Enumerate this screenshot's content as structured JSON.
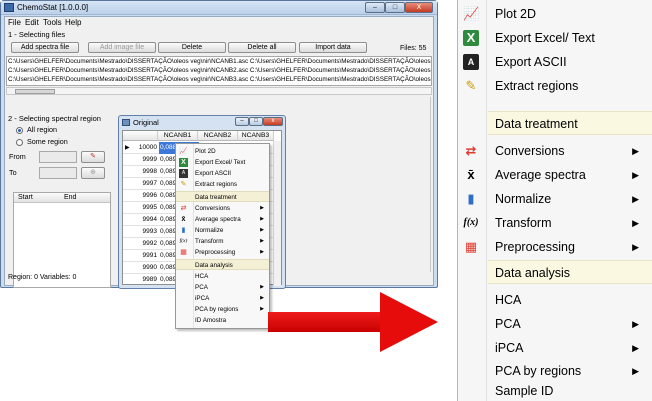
{
  "window": {
    "title": "ChemoStat [1.0.0.0]",
    "buttons": {
      "minimize": "–",
      "maximize": "□",
      "close": "X"
    }
  },
  "menubar": [
    "File",
    "Edit",
    "Tools",
    "Help"
  ],
  "files_section": {
    "title": "1 - Selecting files",
    "buttons": [
      "Add spectra file",
      "Add image file",
      "Delete",
      "Delete all",
      "Import data"
    ],
    "files_count": "Files: 55",
    "paths": [
      "C:\\Users\\GHELFER\\Documents\\Mestrado\\DISSERTAÇÃO\\oleos veg\\nir\\NCANB1.asc   C:\\Users\\GHELFER\\Documents\\Mestrado\\DISSERTAÇÃO\\oleos veg\\",
      "C:\\Users\\GHELFER\\Documents\\Mestrado\\DISSERTAÇÃO\\oleos veg\\nir\\NCANB2.asc   C:\\Users\\GHELFER\\Documents\\Mestrado\\DISSERTAÇÃO\\oleos veg\\",
      "C:\\Users\\GHELFER\\Documents\\Mestrado\\DISSERTAÇÃO\\oleos veg\\nir\\NCANB3.asc   C:\\Users\\GHELFER\\Documents\\Mestrado\\DISSERTAÇÃO\\oleos veg\\"
    ]
  },
  "region_section": {
    "title": "2 - Selecting spectral region",
    "options": [
      "All region",
      "Some region"
    ],
    "selected": "All region",
    "from_label": "From",
    "to_label": "To",
    "table_headers": [
      "Start",
      "End"
    ],
    "status": "Region: 0  Variables: 0"
  },
  "inner_window": {
    "title": "Original",
    "columns": [
      "NCANB1",
      "NCANB2",
      "NCANB3"
    ],
    "rows": [
      {
        "id": "10000",
        "v1": "0,08875",
        "v3": "0,"
      },
      {
        "id": "9999",
        "v1": "0,089170",
        "v3": "0,"
      },
      {
        "id": "9998",
        "v1": "0,08954",
        "v3": "0,"
      },
      {
        "id": "9997",
        "v1": "0,08969",
        "v3": "0,"
      },
      {
        "id": "9996",
        "v1": "0,08956",
        "v3": "0,"
      },
      {
        "id": "9995",
        "v1": "0,08931",
        "v3": "0,"
      },
      {
        "id": "9994",
        "v1": "0,089163",
        "v3": "0,"
      },
      {
        "id": "9993",
        "v1": "0,089205",
        "v3": "0,"
      },
      {
        "id": "9992",
        "v1": "0,089360",
        "v3": "0,"
      },
      {
        "id": "9991",
        "v1": "0,089465",
        "v3": "0,"
      },
      {
        "id": "9990",
        "v1": "0,089375",
        "v3": "0,"
      },
      {
        "id": "9989",
        "v1": "0,089153",
        "v3": "0,"
      }
    ]
  },
  "context_menu_small": [
    {
      "label": "Plot 2D",
      "icon": "plot-2d-icon",
      "glyph": "📈"
    },
    {
      "label": "Export Excel/ Text",
      "icon": "excel-icon",
      "glyph": "X"
    },
    {
      "label": "Export ASCII",
      "icon": "ascii-icon",
      "glyph": "A"
    },
    {
      "label": "Extract regions",
      "icon": "wand-icon",
      "glyph": "✎"
    },
    {
      "label": "Data treatment",
      "header": true
    },
    {
      "label": "Conversions",
      "icon": "conversions-icon",
      "glyph": "⇄",
      "submenu": true
    },
    {
      "label": "Average spectra",
      "icon": "average-icon",
      "glyph": "x̄",
      "submenu": true
    },
    {
      "label": "Normalize",
      "icon": "normalize-icon",
      "glyph": "▮",
      "submenu": true
    },
    {
      "label": "Transform",
      "icon": "transform-icon",
      "glyph": "f(x)",
      "submenu": true
    },
    {
      "label": "Preprocessing",
      "icon": "preprocessing-icon",
      "glyph": "▦",
      "submenu": true
    },
    {
      "label": "Data analysis",
      "header": true
    },
    {
      "label": "HCA"
    },
    {
      "label": "PCA",
      "submenu": true
    },
    {
      "label": "iPCA",
      "submenu": true
    },
    {
      "label": "PCA by regions",
      "submenu": true
    },
    {
      "label": "ID Amostra"
    }
  ],
  "context_menu_big": [
    {
      "label": "Plot 2D",
      "icon": "plot-2d-icon",
      "glyph": "📈"
    },
    {
      "label": "Export Excel/ Text",
      "icon": "excel-icon",
      "glyph": "X"
    },
    {
      "label": "Export ASCII",
      "icon": "ascii-icon",
      "glyph": "A"
    },
    {
      "label": "Extract regions",
      "icon": "wand-icon",
      "glyph": "✎"
    },
    {
      "label": "Data treatment",
      "header": true
    },
    {
      "label": "Conversions",
      "icon": "conversions-icon",
      "glyph": "⇄",
      "submenu": true
    },
    {
      "label": "Average spectra",
      "icon": "average-icon",
      "glyph": "x̄",
      "submenu": true
    },
    {
      "label": "Normalize",
      "icon": "normalize-icon",
      "glyph": "▮",
      "submenu": true
    },
    {
      "label": "Transform",
      "icon": "transform-icon",
      "glyph": "f(x)",
      "submenu": true
    },
    {
      "label": "Preprocessing",
      "icon": "preprocessing-icon",
      "glyph": "▦",
      "submenu": true
    },
    {
      "label": "Data analysis",
      "header": true
    },
    {
      "label": "HCA"
    },
    {
      "label": "PCA",
      "submenu": true
    },
    {
      "label": "iPCA",
      "submenu": true
    },
    {
      "label": "PCA by regions",
      "submenu": true
    },
    {
      "label": "Sample ID"
    }
  ],
  "colors": {
    "arrow": "#e60c0c",
    "selection": "#3b78d8",
    "menu_header_bg": "#fbf8e2",
    "icon_red": "#e03a2f",
    "icon_blue": "#2f6fc8",
    "icon_green": "#2e8b3d"
  }
}
